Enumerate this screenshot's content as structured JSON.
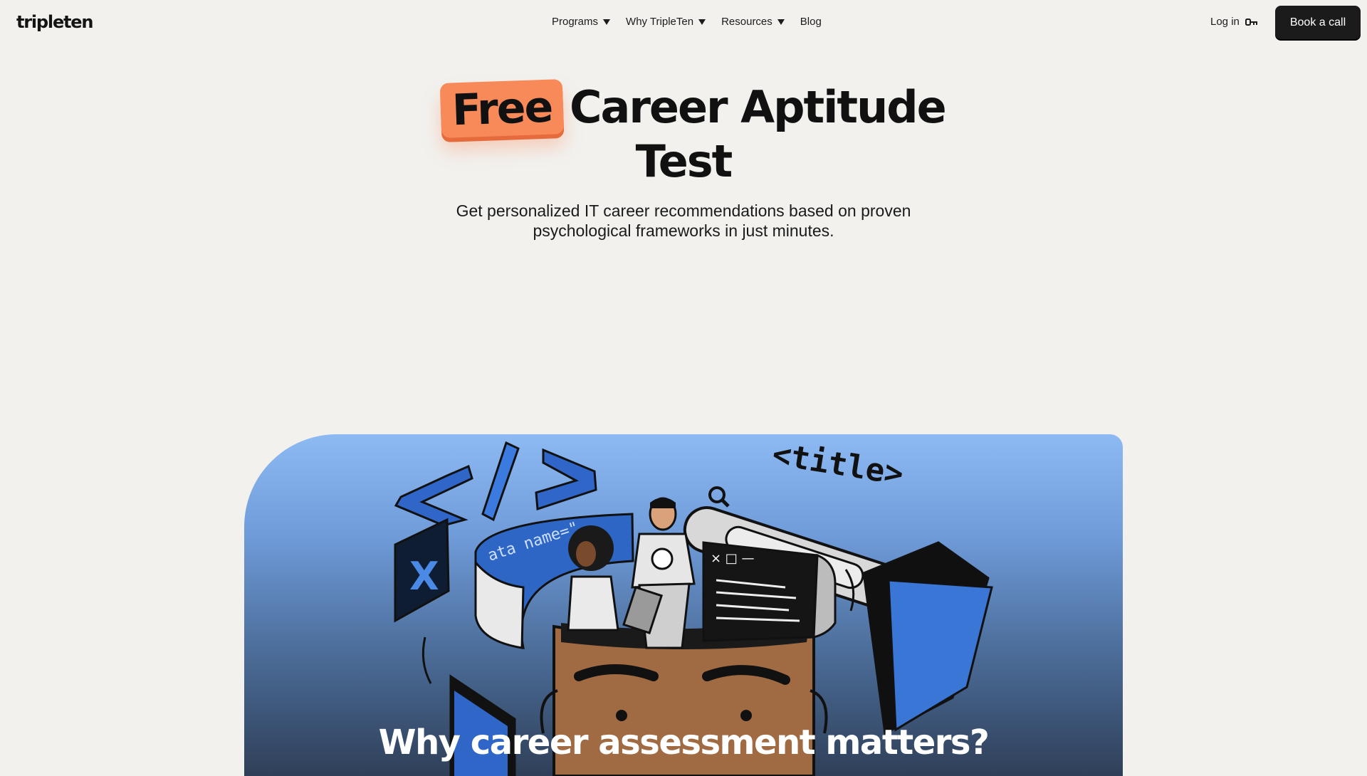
{
  "header": {
    "logo": "tripleten",
    "nav": [
      {
        "label": "Programs",
        "has_caret": true
      },
      {
        "label": "Why TripleTen",
        "has_caret": true
      },
      {
        "label": "Resources",
        "has_caret": true
      },
      {
        "label": "Blog",
        "has_caret": false
      }
    ],
    "login_label": "Log in",
    "cta_label": "Book a call"
  },
  "hero": {
    "badge": "Free",
    "title_rest": "Career Aptitude",
    "title_line2": "Test",
    "subtitle_line1": "Get personalized IT career recommendations based on proven",
    "subtitle_line2": "psychological frameworks in just minutes."
  },
  "illustration": {
    "title_tag": "<title>",
    "code_text": "ata name=\"",
    "section_heading": "Why career assessment matters?"
  },
  "colors": {
    "accent_orange": "#f88a5a",
    "card_top_blue": "#8dbaf3",
    "card_bottom": "#2f3f58",
    "button_dark": "#1b1b1b"
  }
}
